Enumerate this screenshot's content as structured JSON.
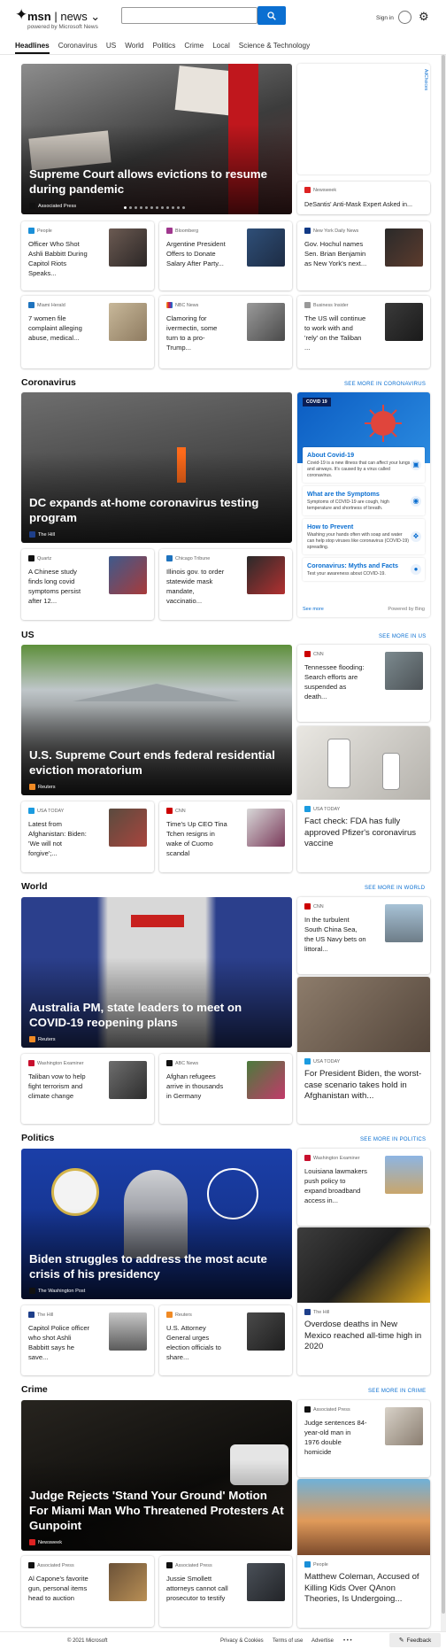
{
  "brand": {
    "msn": "msn",
    "news": "news ⌄",
    "powered": "powered by Microsoft News"
  },
  "header": {
    "signin": "Sign in"
  },
  "nav": [
    "Headlines",
    "Coronavirus",
    "US",
    "World",
    "Politics",
    "Crime",
    "Local",
    "Science & Technology"
  ],
  "ad": {
    "label": "AdChoices"
  },
  "top": {
    "hero": {
      "title": "Supreme Court allows evictions to resume during pandemic",
      "source": "Associated Press"
    },
    "side": {
      "source": "Newsweek",
      "title": "DeSantis' Anti-Mask Expert Asked in..."
    },
    "row1": [
      {
        "source": "People",
        "title": "Officer Who Shot Ashli Babbitt During Capitol Riots Speaks..."
      },
      {
        "source": "Bloomberg",
        "title": "Argentine President Offers to Donate Salary After Party..."
      },
      {
        "source": "New York Daily News",
        "title": "Gov. Hochul names Sen. Brian Benjamin as New York's next..."
      }
    ],
    "row2": [
      {
        "source": "Miami Herald",
        "title": "7 women file complaint alleging abuse, medical..."
      },
      {
        "source": "NBC News",
        "title": "Clamoring for ivermectin, some turn to a pro-Trump..."
      },
      {
        "source": "Business Insider",
        "title": "The US will continue to work with and 'rely' on the Taliban ..."
      }
    ]
  },
  "coronavirus": {
    "heading": "Coronavirus",
    "more": "SEE MORE IN CORONAVIRUS",
    "hero": {
      "title": "DC expands at-home coronavirus testing program",
      "source": "The Hill"
    },
    "row": [
      {
        "source": "Quartz",
        "title": "A Chinese study finds long covid symptoms persist after 12..."
      },
      {
        "source": "Chicago Tribune",
        "title": "Illinois gov. to order statewide mask mandate, vaccinatio..."
      }
    ],
    "widget": {
      "badge": "COVID 19",
      "items": [
        {
          "title": "About Covid-19",
          "desc": "Covid-19 is a new illness that can affect your lungs and airways. It's caused by a virus called coronavirus."
        },
        {
          "title": "What are the Symptoms",
          "desc": "Symptoms of COVID-19 are cough, high temperature and shortness of breath."
        },
        {
          "title": "How to Prevent",
          "desc": "Washing your hands often with soap and water can help stop viruses like coronavirus (COVID-19) spreading."
        },
        {
          "title": "Coronavirus: Myths and Facts",
          "desc": "Test your awareness about COVID-19."
        }
      ],
      "seemore": "See more",
      "powered": "Powered by Bing"
    }
  },
  "us": {
    "heading": "US",
    "more": "SEE MORE IN US",
    "hero": {
      "title": "U.S. Supreme Court ends federal residential eviction moratorium",
      "source": "Reuters"
    },
    "side": {
      "source": "CNN",
      "title": "Tennessee flooding: Search efforts are suspended as death..."
    },
    "tall": {
      "source": "USA TODAY",
      "title": "Fact check: FDA has fully approved Pfizer's coronavirus vaccine"
    },
    "row": [
      {
        "source": "USA TODAY",
        "title": "Latest from Afghanistan: Biden: 'We will not forgive';..."
      },
      {
        "source": "CNN",
        "title": "Time's Up CEO Tina Tchen resigns in wake of Cuomo scandal"
      }
    ]
  },
  "world": {
    "heading": "World",
    "more": "SEE MORE IN WORLD",
    "hero": {
      "title": "Australia PM, state leaders to meet on COVID-19 reopening plans",
      "source": "Reuters"
    },
    "side": {
      "source": "CNN",
      "title": "In the turbulent South China Sea, the US Navy bets on littoral..."
    },
    "tall": {
      "source": "USA TODAY",
      "title": "For President Biden, the worst-case scenario takes hold in Afghanistan with..."
    },
    "row": [
      {
        "source": "Washington Examiner",
        "title": "Taliban vow to help fight terrorism and climate change"
      },
      {
        "source": "ABC News",
        "title": "Afghan refugees arrive in thousands in Germany"
      }
    ]
  },
  "politics": {
    "heading": "Politics",
    "more": "SEE MORE IN POLITICS",
    "hero": {
      "title": "Biden struggles to address the most acute crisis of his presidency",
      "source": "The Washington Post"
    },
    "side": {
      "source": "Washington Examiner",
      "title": "Louisiana lawmakers push policy to expand broadband access in..."
    },
    "tall": {
      "source": "The Hill",
      "title": "Overdose deaths in New Mexico reached all-time high in 2020"
    },
    "row": [
      {
        "source": "The Hill",
        "title": "Capitol Police officer who shot Ashli Babbitt says he save..."
      },
      {
        "source": "Reuters",
        "title": "U.S. Attorney General urges election officials to share..."
      }
    ]
  },
  "crime": {
    "heading": "Crime",
    "more": "SEE MORE IN CRIME",
    "hero": {
      "title": "Judge Rejects 'Stand Your Ground' Motion For Miami Man Who Threatened Protesters At Gunpoint",
      "source": "Newsweek"
    },
    "side": {
      "source": "Associated Press",
      "title": "Judge sentences 84-year-old man in 1976 double homicide"
    },
    "tall": {
      "source": "People",
      "title": "Matthew Coleman, Accused of Killing Kids Over QAnon Theories, Is Undergoing..."
    },
    "row": [
      {
        "source": "Associated Press",
        "title": "Al Capone's favorite gun, personal items head to auction"
      },
      {
        "source": "Associated Press",
        "title": "Jussie Smollett attorneys cannot call prosecutor to testify"
      }
    ]
  },
  "footer": {
    "copyright": "© 2021 Microsoft",
    "privacy": "Privacy & Cookies",
    "terms": "Terms of use",
    "advertise": "Advertise",
    "more": "• • •",
    "feedback": "Feedback"
  }
}
